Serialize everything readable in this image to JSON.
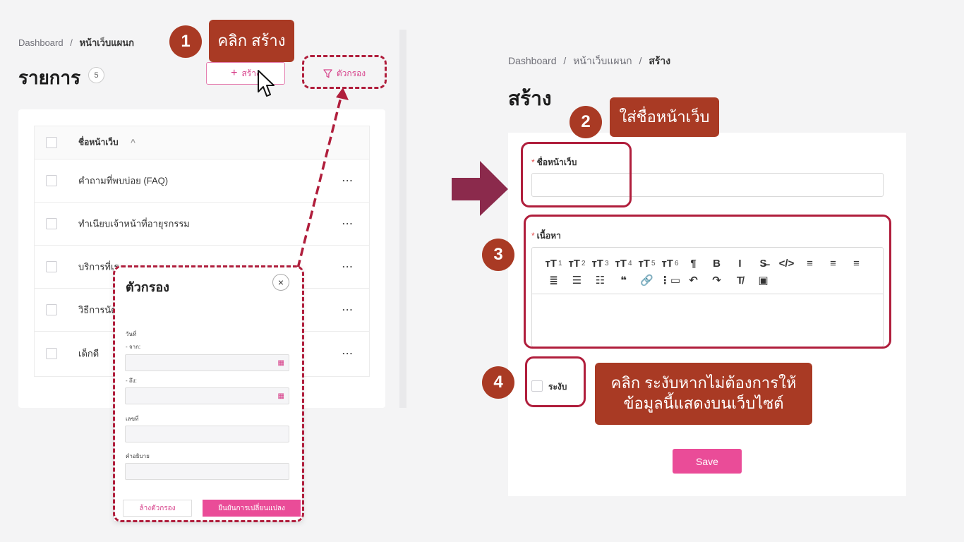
{
  "left": {
    "breadcrumb": {
      "home": "Dashboard",
      "sep": "/",
      "current": "หน้าเว็บแผนก"
    },
    "title": "รายการ",
    "count": "5",
    "create_label": "สร้าง",
    "filter_label": "ตัวกรอง",
    "table": {
      "header": "ชื่อหน้าเว็บ",
      "rows": [
        {
          "name": "คำถามที่พบบ่อย (FAQ)"
        },
        {
          "name": "ทำเนียบเจ้าหน้าที่อายุรกรรม"
        },
        {
          "name": "บริการที่เร"
        },
        {
          "name": "วิธีการนัด"
        },
        {
          "name": "เด็กดี"
        }
      ],
      "row_menu": "···"
    },
    "filter_modal": {
      "title": "ตัวกรอง",
      "close": "×",
      "date_label": "วันที่",
      "from_label": "- จาก:",
      "to_label": "- ถึง:",
      "number_label": "เลขที่",
      "desc_label": "คำอธิบาย",
      "clear_label": "ล้างตัวกรอง",
      "confirm_label": "ยืนยันการเปลี่ยนแปลง"
    }
  },
  "right": {
    "breadcrumb": {
      "home": "Dashboard",
      "sep1": "/",
      "mid": "หน้าเว็บแผนก",
      "sep2": "/",
      "current": "สร้าง"
    },
    "title": "สร้าง",
    "name_label": "ชื่อหน้าเว็บ",
    "content_label": "เนื้อหา",
    "required_mark": "*",
    "suspend_label": "ระงับ",
    "save_label": "Save",
    "toolbar": [
      {
        "icon": "heading-1-icon",
        "glyph": "ᴛT",
        "sup": "1"
      },
      {
        "icon": "heading-2-icon",
        "glyph": "ᴛT",
        "sup": "2"
      },
      {
        "icon": "heading-3-icon",
        "glyph": "ᴛT",
        "sup": "3"
      },
      {
        "icon": "heading-4-icon",
        "glyph": "ᴛT",
        "sup": "4"
      },
      {
        "icon": "heading-5-icon",
        "glyph": "ᴛT",
        "sup": "5"
      },
      {
        "icon": "heading-6-icon",
        "glyph": "ᴛT",
        "sup": "6"
      },
      {
        "icon": "paragraph-icon",
        "glyph": "¶",
        "sup": ""
      },
      {
        "icon": "bold-icon",
        "glyph": "B",
        "sup": ""
      },
      {
        "icon": "italic-icon",
        "glyph": "I",
        "sup": ""
      },
      {
        "icon": "strikethrough-icon",
        "glyph": "S̶",
        "sup": ""
      },
      {
        "icon": "code-icon",
        "glyph": "</>",
        "sup": ""
      },
      {
        "icon": "align-left-icon",
        "glyph": "≡",
        "sup": ""
      },
      {
        "icon": "align-center-icon",
        "glyph": "≡",
        "sup": ""
      },
      {
        "icon": "align-right-icon",
        "glyph": "≡",
        "sup": ""
      },
      {
        "icon": "align-justify-icon",
        "glyph": "≣",
        "sup": ""
      },
      {
        "icon": "bullet-list-icon",
        "glyph": "☰",
        "sup": ""
      },
      {
        "icon": "ordered-list-icon",
        "glyph": "☷",
        "sup": ""
      },
      {
        "icon": "quote-icon",
        "glyph": "❝",
        "sup": ""
      },
      {
        "icon": "link-icon",
        "glyph": "🔗",
        "sup": ""
      },
      {
        "icon": "page-break-icon",
        "glyph": "⋮▭",
        "sup": ""
      },
      {
        "icon": "undo-icon",
        "glyph": "↶",
        "sup": ""
      },
      {
        "icon": "redo-icon",
        "glyph": "↷",
        "sup": ""
      },
      {
        "icon": "clear-format-icon",
        "glyph": "T̸",
        "sup": ""
      },
      {
        "icon": "image-icon",
        "glyph": "▣",
        "sup": ""
      }
    ]
  },
  "annotations": {
    "step1": "1",
    "step1_text": "คลิก สร้าง",
    "step2": "2",
    "step2_text": "ใส่ชื่อหน้าเว็บ",
    "step3": "3",
    "step4": "4",
    "step4_text_line1": "คลิก ระงับหากไม่ต้องการให้",
    "step4_text_line2": "ข้อมูลนี้แสดงบนเว็บไซต์"
  },
  "colors": {
    "accent": "#ea4c98",
    "annotation": "#a93a24",
    "dash": "#b01e3c"
  }
}
